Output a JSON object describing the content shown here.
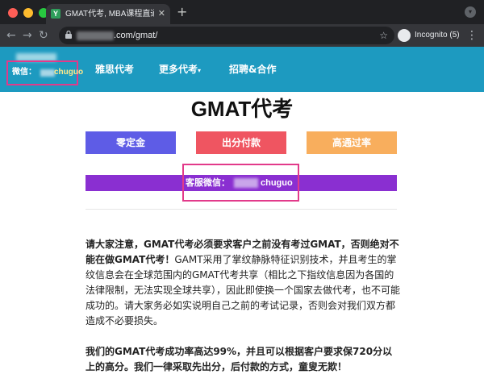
{
  "browser": {
    "tab_title": "GMAT代考, MBA课程直通车, 找",
    "favicon_letter": "Y",
    "url_visible": ".com/gmat/",
    "profile": "Incognito (5)"
  },
  "header": {
    "wechat_label": "微信：",
    "wechat_id": "chuguo",
    "nav": [
      "雅思代考",
      "更多代考",
      "招聘&合作"
    ]
  },
  "main": {
    "title": "GMAT代考",
    "buttons": [
      "零定金",
      "出分付款",
      "高通过率"
    ],
    "service_label": "客服微信：",
    "service_id": "chuguo",
    "para1_bold": "请大家注意，GMAT代考必须要求客户之前没有考过GMAT，否则绝对不能在做GMAT代考！",
    "para1_rest": "GAMT采用了掌纹静脉特征识别技术，并且考生的掌纹信息会在全球范围内的GMAT代考共享（相比之下指纹信息因为各国的法律限制，无法实现全球共享），因此即使换一个国家去做代考，也不可能成功的。请大家务必如实说明自己之前的考试记录，否则会对我们双方都造成不必要损失。",
    "para2": "我们的GMAT代考成功率高达99%，并且可以根据客户要求保720分以上的高分。我们一律采取先出分，后付款的方式，童叟无欺！"
  },
  "colors": {
    "header_bg": "#1d9ac0",
    "btn_blue": "#5e5ce6",
    "btn_red": "#ef5561",
    "btn_orange": "#f8ae5d",
    "service_bar": "#8a2fd1",
    "highlight_box": "#e23a8a"
  }
}
